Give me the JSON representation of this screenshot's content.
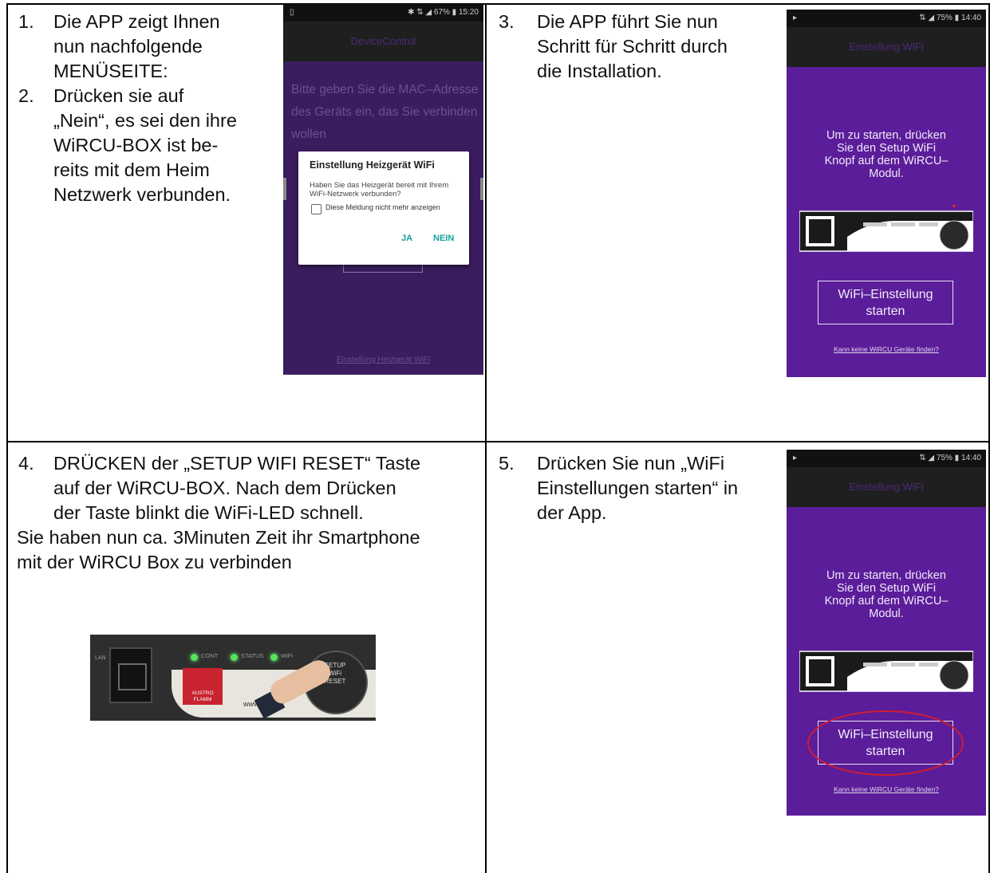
{
  "cells": {
    "c1": {
      "item1_num": "1.",
      "item1_lines": [
        "Die APP zeigt Ihnen",
        "nun nachfolgende",
        "MENÜSEITE:"
      ],
      "item2_num": "2.",
      "item2_lines": [
        "Drücken sie auf",
        "„Nein“, es sei den ihre",
        "WiRCU-BOX ist be-",
        "reits mit dem Heim",
        "Netzwerk verbunden."
      ]
    },
    "c3": {
      "item_num": "3.",
      "lines": [
        "Die APP führt Sie nun",
        "Schritt für Schritt durch",
        "die Installation."
      ]
    },
    "c4": {
      "item_num": "4.",
      "lines": [
        "DRÜCKEN der „SETUP WIFI RESET“ Taste",
        "auf der WiRCU-BOX. Nach dem Drücken",
        "der Taste blinkt die WiFi-LED schnell."
      ],
      "para_lines": [
        "Sie haben nun ca. 3Minuten Zeit ihr Smartphone",
        "mit der WiRCU Box zu verbinden"
      ]
    },
    "c5": {
      "item_num": "5.",
      "lines": [
        "Drücken Sie nun „WiFi",
        "Einstellungen starten“ in",
        "der App."
      ]
    }
  },
  "phone1": {
    "status_right": "✱ ⇅ ◢ 67% ▮ 15:20",
    "status_left": "▯",
    "title": "DeviceControl",
    "bg_lines": [
      "Bitte geben Sie die MAC–Adresse",
      "des Geräts ein, das Sie verbinden",
      "wollen"
    ],
    "dialog_title": "Einstellung Heizgerät WiFi",
    "dialog_message": "Haben Sie das Heizgerät bereit mit Ihrem WiFi-Netzwerk verbunden?",
    "dialog_checkbox": "Diese Meldung nicht mehr anzeigen",
    "btn_yes": "JA",
    "btn_no": "NEIN",
    "footer": "Einstellung Heizgerät WiFi"
  },
  "phone3": {
    "status_left": "▸",
    "status_right": "⇅ ◢ 75% ▮ 14:40",
    "title": "Einstellung WiFi",
    "message_lines": [
      "Um zu starten, drücken",
      "Sie den Setup WiFi",
      "Knopf auf dem WiRCU–",
      "Modul."
    ],
    "button_lines": [
      "WiFi–Einstellung",
      "starten"
    ],
    "help": "Kann keine WiRCU Geräte finden?"
  },
  "phone5": {
    "status_left": "▸",
    "status_right": "⇅ ◢ 75% ▮ 14:40",
    "title": "Einstellung WiFi",
    "message_lines": [
      "Um zu starten, drücken",
      "Sie den Setup WiFi",
      "Knopf auf dem WiRCU–",
      "Modul."
    ],
    "button_lines": [
      "WiFi–Einstellung",
      "starten"
    ],
    "help": "Kann keine WiRCU Geräte finden?"
  },
  "photo": {
    "led1": "CONT",
    "led2": "STATUS",
    "led3": "WiFi",
    "knob_text": "SETUP WiFi RESET",
    "logo_text": "AUSTRO FLAMM",
    "www": "www.                  .com",
    "side": "LAN"
  },
  "colors": {
    "app_purple": "#5b1d9a",
    "dialog_accent": "#12a39a",
    "highlight_red": "#d11c2d",
    "led_green": "#55e35b"
  }
}
